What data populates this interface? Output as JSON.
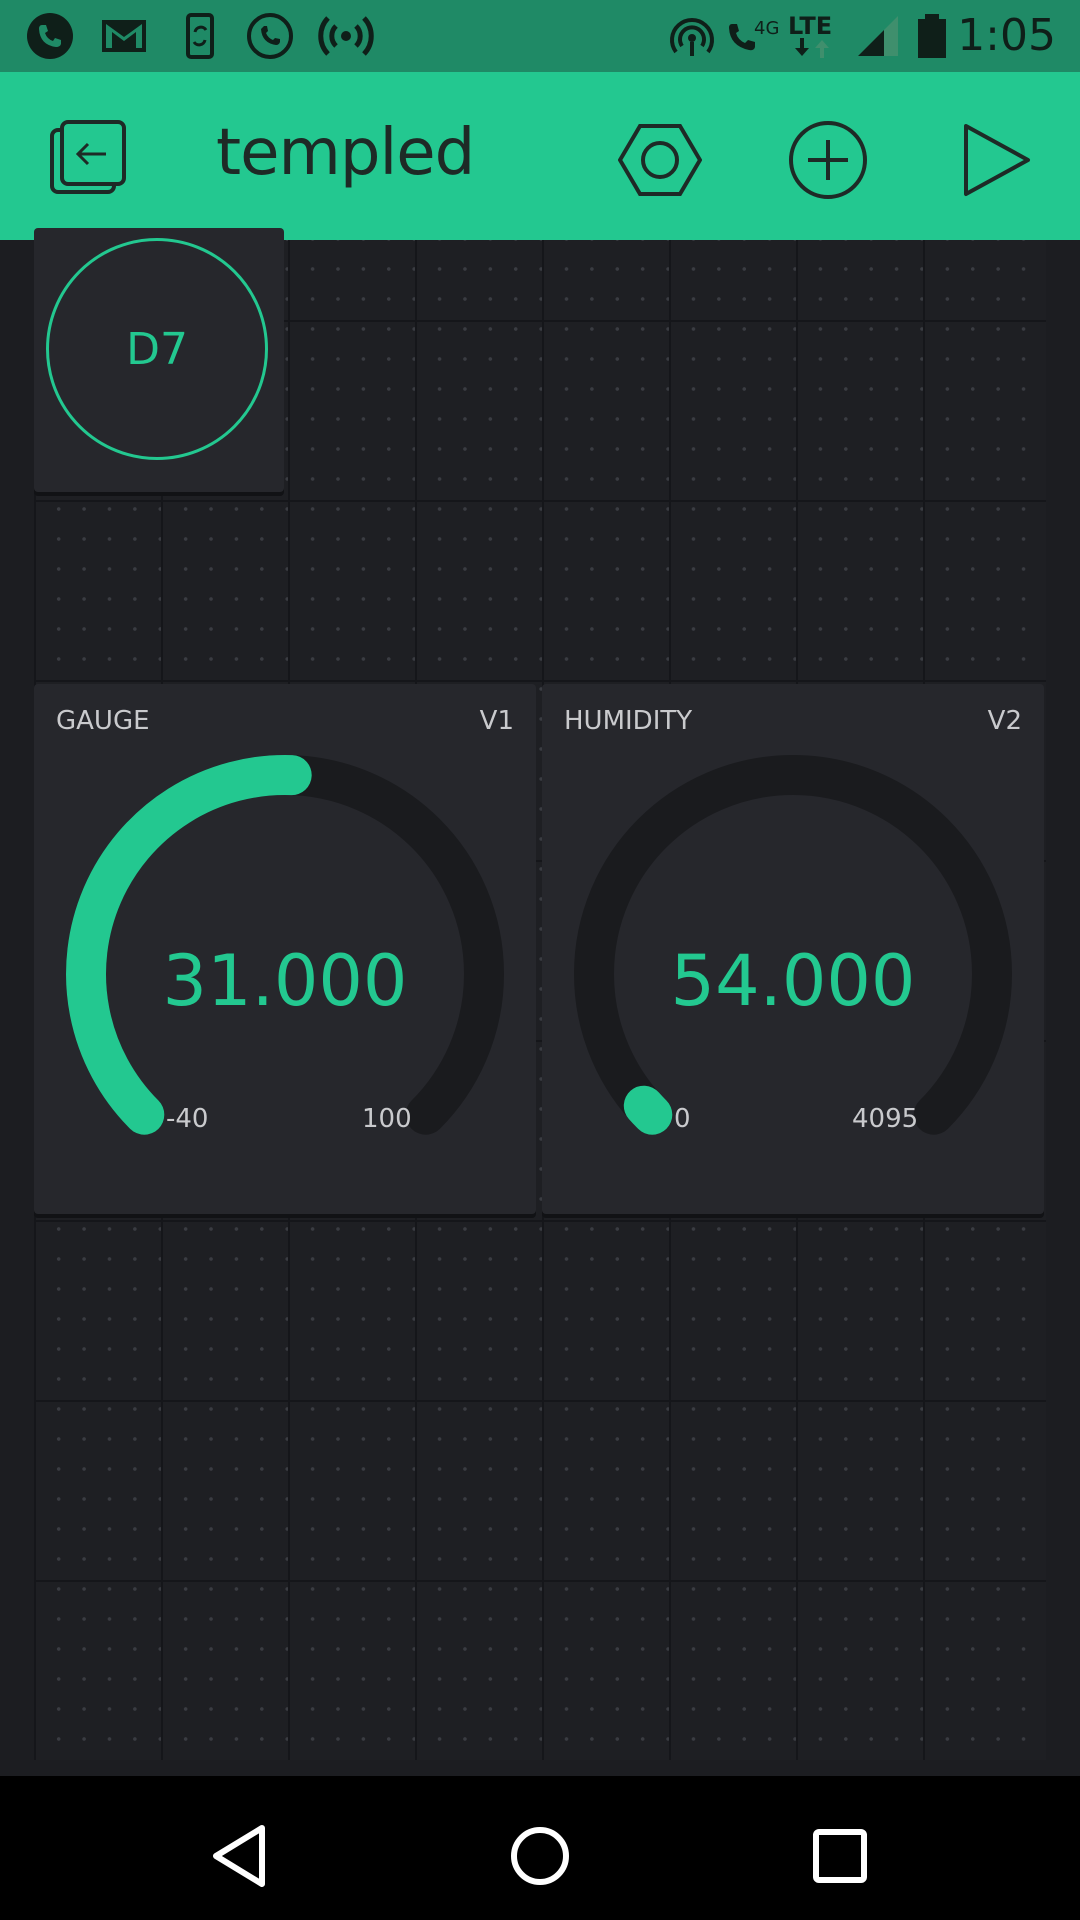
{
  "status_bar": {
    "time": "1:05",
    "left_icons": [
      "phone-icon",
      "gmail-icon",
      "phone-sync-icon",
      "call-forward-icon",
      "wireless-broadcast-icon"
    ],
    "right_icons": [
      "hotspot-icon",
      "volte-call-icon",
      "lte-icon",
      "signal-icon",
      "battery-icon"
    ],
    "network_labels": {
      "call": "4G",
      "data": "LTE"
    },
    "color": "#1f8a66"
  },
  "app_bar": {
    "title": "templed",
    "actions": [
      "exit-icon",
      "settings-hexagon-icon",
      "add-widget-icon",
      "play-icon"
    ],
    "color": "#23c890"
  },
  "widgets": {
    "button": {
      "label": "D7"
    },
    "gauge": {
      "title": "GAUGE",
      "pin": "V1",
      "value_text": "31.000",
      "value": 31,
      "min": "-40",
      "max": "100"
    },
    "humidity": {
      "title": "HUMIDITY",
      "pin": "V2",
      "value_text": "54.000",
      "value": 54,
      "min": "0",
      "max": "4095"
    }
  },
  "nav_bar": {
    "buttons": [
      "back-icon",
      "home-icon",
      "recents-icon"
    ]
  },
  "colors": {
    "accent": "#23c890",
    "canvas": "#1e1f23",
    "widget_bg": "#26272c",
    "track": "#1a1b1e"
  }
}
